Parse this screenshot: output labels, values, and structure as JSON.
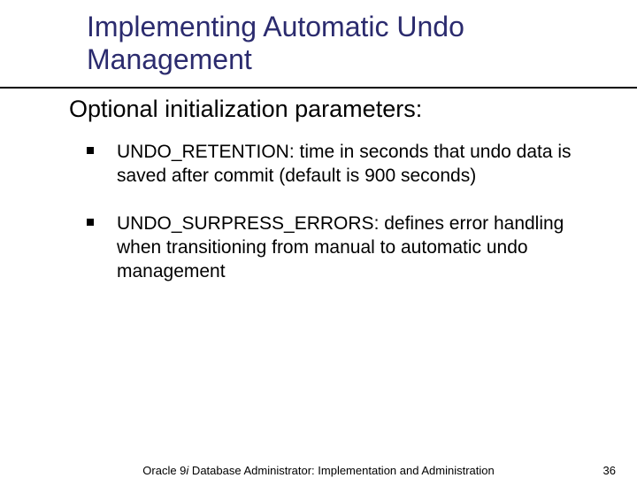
{
  "title": "Implementing Automatic Undo Management",
  "subhead": "Optional initialization parameters:",
  "bullets": [
    "UNDO_RETENTION: time in seconds that undo data is saved after commit (default is 900 seconds)",
    "UNDO_SURPRESS_ERRORS: defines error handling when transitioning from manual to automatic undo management"
  ],
  "footer": {
    "product_prefix": "Oracle 9",
    "product_ital": "i",
    "product_suffix": " Database Administrator: Implementation and Administration",
    "page_number": "36"
  }
}
